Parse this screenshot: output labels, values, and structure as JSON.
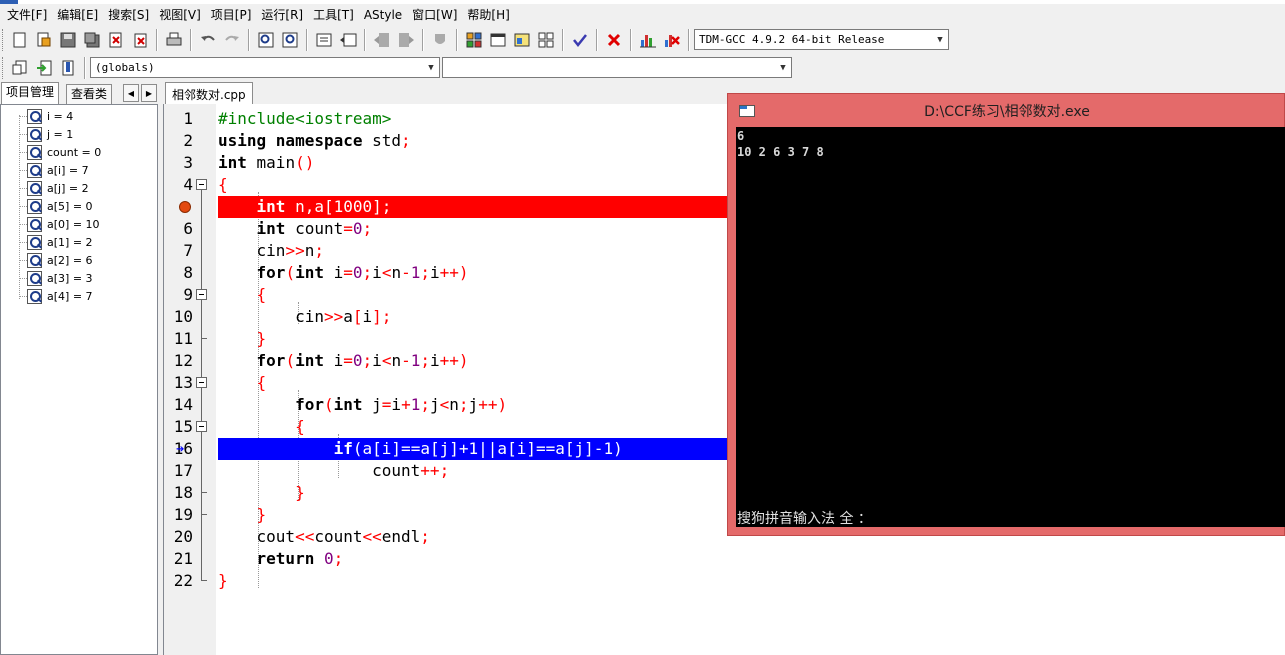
{
  "menu": [
    "文件[F]",
    "编辑[E]",
    "搜索[S]",
    "视图[V]",
    "项目[P]",
    "运行[R]",
    "工具[T]",
    "AStyle",
    "窗口[W]",
    "帮助[H]"
  ],
  "toolbar": {
    "compiler": "TDM-GCC 4.9.2 64-bit Release",
    "scope": "(globals)",
    "symbol": ""
  },
  "left_panel": {
    "tabs": [
      "项目管理",
      "查看类"
    ],
    "watches": [
      "i = 4",
      "j = 1",
      "count = 0",
      "a[i] = 7",
      "a[j] = 2",
      "a[5] = 0",
      "a[0] = 10",
      "a[1] = 2",
      "a[2] = 6",
      "a[3] = 3",
      "a[4] = 7"
    ]
  },
  "editor": {
    "tab": "相邻数对.cpp",
    "line_numbers": [
      "1",
      "2",
      "3",
      "4",
      "5",
      "6",
      "7",
      "8",
      "9",
      "10",
      "11",
      "12",
      "13",
      "14",
      "15",
      "16",
      "17",
      "18",
      "19",
      "20",
      "21",
      "22"
    ]
  },
  "console": {
    "title": "D:\\CCF练习\\相邻数对.exe",
    "lines": [
      "6",
      "10 2 6 3 7 8"
    ],
    "ime": "搜狗拼音输入法 全 ："
  },
  "colors": {
    "breakpoint_line": "#ff0000",
    "exec_line": "#0000ff",
    "console_frame": "#e46a6a",
    "keyword": "#000000",
    "preprocessor": "#008000",
    "symbol": "#ff0000",
    "number": "#800080"
  }
}
